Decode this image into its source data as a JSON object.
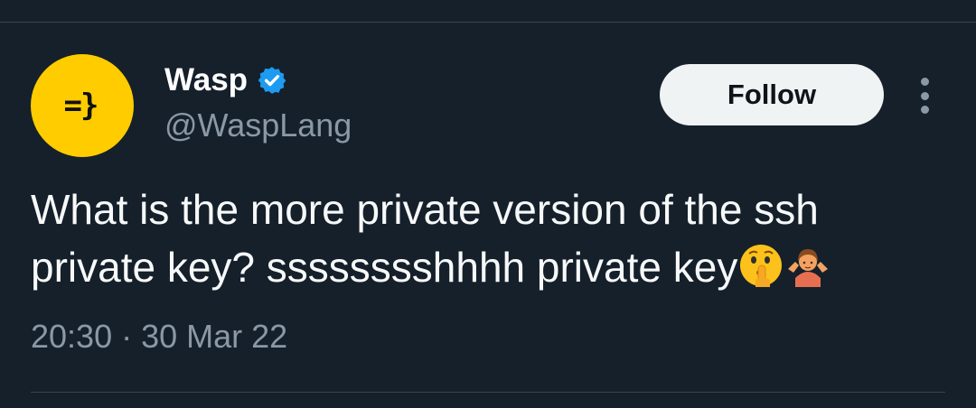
{
  "tweet": {
    "author": {
      "display_name": "Wasp",
      "handle": "@WaspLang",
      "avatar_text": "=}",
      "verified": true
    },
    "follow_label": "Follow",
    "text": "What is the more private version of the ssh private key? sssssssshhhh private key",
    "emojis": [
      "shushing-face-emoji",
      "person-shrugging-emoji"
    ],
    "timestamp": "20:30 · 30 Mar 22"
  },
  "colors": {
    "background": "#15202b",
    "avatar_bg": "#ffcc00",
    "verified_badge": "#1d9bf0",
    "secondary_text": "#8b98a5",
    "follow_button_bg": "#eff3f4"
  }
}
